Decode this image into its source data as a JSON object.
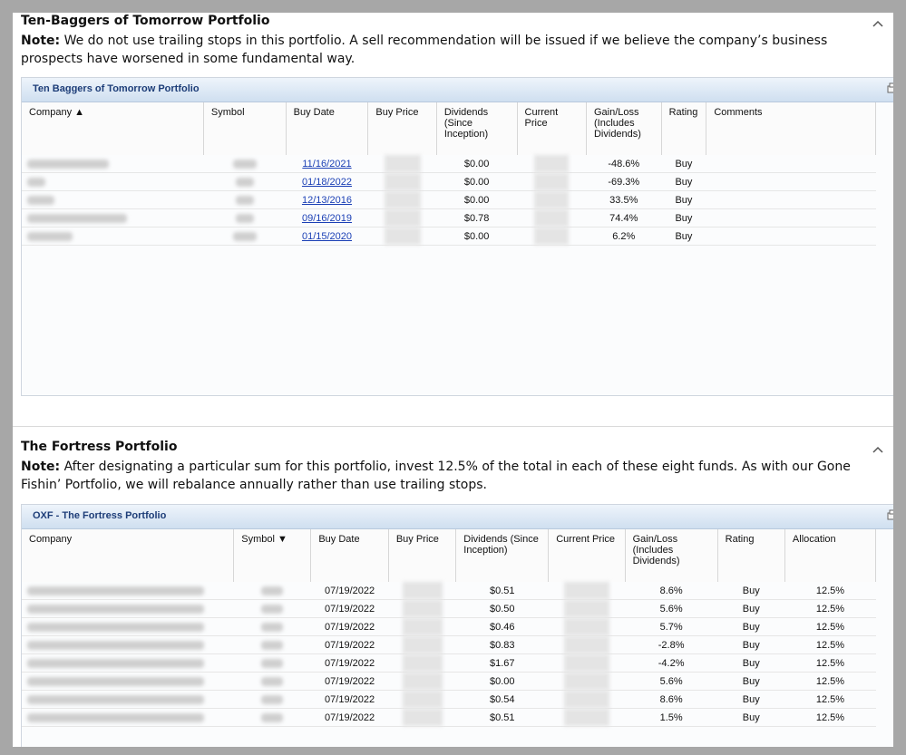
{
  "tenbaggers": {
    "title": "Ten-Baggers of Tomorrow Portfolio",
    "note_label": "Note:",
    "note_text": " We do not use trailing stops in this portfolio. A sell recommendation will be issued if we believe the company’s business prospects have worsened in some fundamental way.",
    "panel_title": "Ten Baggers of Tomorrow Portfolio",
    "columns": [
      "Company ▲",
      "Symbol",
      "Buy Date",
      "Buy Price",
      "Dividends (Since Inception)",
      "Current Price",
      "Gain/Loss (Includes Dividends)",
      "Rating",
      "Comments"
    ],
    "rows": [
      {
        "buy_date": "11/16/2021",
        "dividends": "$0.00",
        "gain_loss": "-48.6%",
        "rating": "Buy"
      },
      {
        "buy_date": "01/18/2022",
        "dividends": "$0.00",
        "gain_loss": "-69.3%",
        "rating": "Buy"
      },
      {
        "buy_date": "12/13/2016",
        "dividends": "$0.00",
        "gain_loss": "33.5%",
        "rating": "Buy"
      },
      {
        "buy_date": "09/16/2019",
        "dividends": "$0.78",
        "gain_loss": "74.4%",
        "rating": "Buy"
      },
      {
        "buy_date": "01/15/2020",
        "dividends": "$0.00",
        "gain_loss": "6.2%",
        "rating": "Buy"
      }
    ]
  },
  "fortress": {
    "title": "The Fortress Portfolio",
    "note_label": "Note:",
    "note_text": " After designating a particular sum for this portfolio, invest 12.5% of the total in each of these eight funds. As with our Gone Fishin’ Portfolio, we will rebalance annually rather than use trailing stops.",
    "panel_title": "OXF - The Fortress Portfolio",
    "columns": [
      "Company",
      "Symbol ▼",
      "Buy Date",
      "Buy Price",
      "Dividends (Since Inception)",
      "Current Price",
      "Gain/Loss (Includes Dividends)",
      "Rating",
      "Allocation"
    ],
    "rows": [
      {
        "buy_date": "07/19/2022",
        "dividends": "$0.51",
        "gain_loss": "8.6%",
        "rating": "Buy",
        "allocation": "12.5%"
      },
      {
        "buy_date": "07/19/2022",
        "dividends": "$0.50",
        "gain_loss": "5.6%",
        "rating": "Buy",
        "allocation": "12.5%"
      },
      {
        "buy_date": "07/19/2022",
        "dividends": "$0.46",
        "gain_loss": "5.7%",
        "rating": "Buy",
        "allocation": "12.5%"
      },
      {
        "buy_date": "07/19/2022",
        "dividends": "$0.83",
        "gain_loss": "-2.8%",
        "rating": "Buy",
        "allocation": "12.5%"
      },
      {
        "buy_date": "07/19/2022",
        "dividends": "$1.67",
        "gain_loss": "-4.2%",
        "rating": "Buy",
        "allocation": "12.5%"
      },
      {
        "buy_date": "07/19/2022",
        "dividends": "$0.00",
        "gain_loss": "5.6%",
        "rating": "Buy",
        "allocation": "12.5%"
      },
      {
        "buy_date": "07/19/2022",
        "dividends": "$0.54",
        "gain_loss": "8.6%",
        "rating": "Buy",
        "allocation": "12.5%"
      },
      {
        "buy_date": "07/19/2022",
        "dividends": "$0.51",
        "gain_loss": "1.5%",
        "rating": "Buy",
        "allocation": "12.5%"
      }
    ]
  },
  "icons": {
    "collapse": "chevron-up-icon",
    "print": "print-icon"
  }
}
